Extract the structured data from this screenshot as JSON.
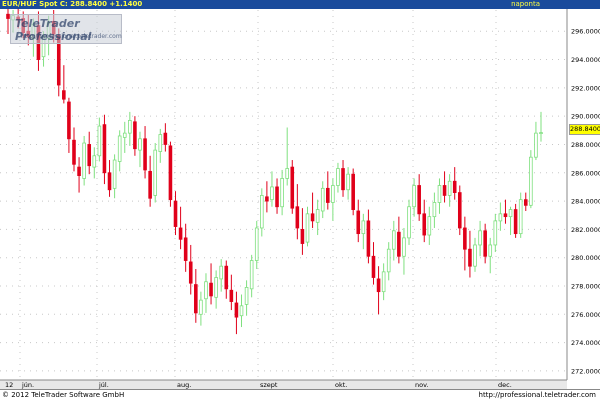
{
  "header": {
    "symbol_line": "EUR/HUF Spot  C: 288.8400  +1.1400",
    "timeframe": "naponta"
  },
  "logo": {
    "title": "TeleTrader Professional",
    "url": "http://professional.teletrader.com"
  },
  "footer": {
    "copyright": "© 2012 TeleTrader Software GmbH",
    "url": "http://professional.teletrader.com"
  },
  "colors": {
    "up": "#7fe07f",
    "down": "#e0001a",
    "grid": "#c8c8c8",
    "axis_bg": "#ffffff",
    "header_bg": "#1a4b9c",
    "last_tag": "#ffff00"
  },
  "chart_data": {
    "type": "candlestick",
    "title": "EUR/HUF Spot",
    "last_close": "288.8400",
    "change": "+1.1400",
    "y_ticks": [
      "296.0000",
      "294.0000",
      "292.0000",
      "290.0000",
      "288.0000",
      "286.0000",
      "284.0000",
      "282.0000",
      "280.0000",
      "278.0000",
      "276.0000",
      "274.0000",
      "272.0000"
    ],
    "ylim": [
      271.5,
      297.5
    ],
    "x_month_labels": [
      "12",
      "jún.",
      "júl.",
      "aug.",
      "szept",
      "okt.",
      "nov.",
      "dec."
    ],
    "grid": true,
    "series": [
      {
        "o": 297.2,
        "h": 297.6,
        "l": 295.8,
        "c": 296.9
      },
      {
        "o": 296.8,
        "h": 297.5,
        "l": 295.9,
        "c": 297.1
      },
      {
        "o": 297.0,
        "h": 297.6,
        "l": 296.2,
        "c": 296.8
      },
      {
        "o": 296.9,
        "h": 297.4,
        "l": 295.5,
        "c": 295.9
      },
      {
        "o": 296.0,
        "h": 297.2,
        "l": 295.0,
        "c": 295.6
      },
      {
        "o": 295.5,
        "h": 296.9,
        "l": 294.2,
        "c": 296.5
      },
      {
        "o": 296.4,
        "h": 297.4,
        "l": 293.2,
        "c": 294.0
      },
      {
        "o": 294.2,
        "h": 296.0,
        "l": 293.5,
        "c": 295.6
      },
      {
        "o": 295.5,
        "h": 297.1,
        "l": 294.3,
        "c": 296.6
      },
      {
        "o": 296.7,
        "h": 297.5,
        "l": 295.2,
        "c": 295.8
      },
      {
        "o": 295.7,
        "h": 296.2,
        "l": 291.4,
        "c": 292.2
      },
      {
        "o": 291.8,
        "h": 293.6,
        "l": 290.9,
        "c": 291.2
      },
      {
        "o": 291.0,
        "h": 291.3,
        "l": 287.4,
        "c": 288.4
      },
      {
        "o": 288.3,
        "h": 289.2,
        "l": 286.1,
        "c": 286.6
      },
      {
        "o": 286.4,
        "h": 287.1,
        "l": 284.6,
        "c": 285.8
      },
      {
        "o": 285.6,
        "h": 288.6,
        "l": 285.1,
        "c": 288.1
      },
      {
        "o": 288.0,
        "h": 288.9,
        "l": 285.9,
        "c": 286.5
      },
      {
        "o": 286.4,
        "h": 287.8,
        "l": 285.6,
        "c": 287.2
      },
      {
        "o": 287.2,
        "h": 289.9,
        "l": 286.8,
        "c": 289.3
      },
      {
        "o": 289.4,
        "h": 290.1,
        "l": 285.2,
        "c": 286.0
      },
      {
        "o": 286.0,
        "h": 286.9,
        "l": 284.3,
        "c": 284.8
      },
      {
        "o": 284.9,
        "h": 287.3,
        "l": 284.2,
        "c": 286.9
      },
      {
        "o": 286.8,
        "h": 289.0,
        "l": 286.1,
        "c": 288.6
      },
      {
        "o": 288.5,
        "h": 289.6,
        "l": 287.4,
        "c": 288.8
      },
      {
        "o": 288.8,
        "h": 290.3,
        "l": 287.9,
        "c": 289.7
      },
      {
        "o": 289.6,
        "h": 290.0,
        "l": 287.2,
        "c": 287.7
      },
      {
        "o": 287.6,
        "h": 288.9,
        "l": 286.4,
        "c": 288.4
      },
      {
        "o": 288.4,
        "h": 289.3,
        "l": 285.6,
        "c": 286.2
      },
      {
        "o": 286.1,
        "h": 287.2,
        "l": 283.6,
        "c": 284.2
      },
      {
        "o": 284.4,
        "h": 288.1,
        "l": 283.9,
        "c": 287.6
      },
      {
        "o": 287.5,
        "h": 289.1,
        "l": 286.7,
        "c": 288.7
      },
      {
        "o": 288.8,
        "h": 289.5,
        "l": 287.5,
        "c": 288.0
      },
      {
        "o": 287.9,
        "h": 288.2,
        "l": 283.6,
        "c": 284.1
      },
      {
        "o": 284.0,
        "h": 284.7,
        "l": 281.6,
        "c": 282.2
      },
      {
        "o": 282.1,
        "h": 283.6,
        "l": 280.6,
        "c": 281.3
      },
      {
        "o": 281.4,
        "h": 282.4,
        "l": 279.0,
        "c": 279.8
      },
      {
        "o": 279.7,
        "h": 280.9,
        "l": 277.4,
        "c": 278.2
      },
      {
        "o": 278.1,
        "h": 279.2,
        "l": 275.4,
        "c": 276.1
      },
      {
        "o": 276.0,
        "h": 277.6,
        "l": 275.2,
        "c": 277.0
      },
      {
        "o": 277.1,
        "h": 278.9,
        "l": 276.1,
        "c": 278.3
      },
      {
        "o": 278.2,
        "h": 279.6,
        "l": 276.7,
        "c": 277.3
      },
      {
        "o": 277.2,
        "h": 279.1,
        "l": 276.4,
        "c": 278.6
      },
      {
        "o": 278.5,
        "h": 279.9,
        "l": 277.6,
        "c": 279.4
      },
      {
        "o": 279.4,
        "h": 279.8,
        "l": 277.1,
        "c": 277.8
      },
      {
        "o": 277.7,
        "h": 278.8,
        "l": 276.3,
        "c": 276.9
      },
      {
        "o": 276.8,
        "h": 277.6,
        "l": 274.6,
        "c": 275.8
      },
      {
        "o": 275.9,
        "h": 277.4,
        "l": 275.1,
        "c": 276.6
      },
      {
        "o": 276.7,
        "h": 278.4,
        "l": 275.9,
        "c": 277.9
      },
      {
        "o": 277.8,
        "h": 280.2,
        "l": 277.2,
        "c": 279.8
      },
      {
        "o": 279.8,
        "h": 282.6,
        "l": 279.2,
        "c": 282.1
      },
      {
        "o": 282.1,
        "h": 284.9,
        "l": 281.5,
        "c": 284.4
      },
      {
        "o": 284.3,
        "h": 285.4,
        "l": 283.2,
        "c": 284.0
      },
      {
        "o": 284.1,
        "h": 286.1,
        "l": 283.6,
        "c": 285.0
      },
      {
        "o": 285.0,
        "h": 285.6,
        "l": 283.1,
        "c": 283.6
      },
      {
        "o": 283.6,
        "h": 286.2,
        "l": 283.0,
        "c": 285.6
      },
      {
        "o": 285.6,
        "h": 289.2,
        "l": 285.1,
        "c": 286.3
      },
      {
        "o": 286.4,
        "h": 286.9,
        "l": 283.1,
        "c": 283.5
      },
      {
        "o": 283.6,
        "h": 285.2,
        "l": 281.3,
        "c": 282.1
      },
      {
        "o": 282.0,
        "h": 283.5,
        "l": 280.2,
        "c": 281.0
      },
      {
        "o": 281.1,
        "h": 283.6,
        "l": 280.8,
        "c": 283.1
      },
      {
        "o": 283.1,
        "h": 284.6,
        "l": 282.1,
        "c": 282.6
      },
      {
        "o": 282.5,
        "h": 284.1,
        "l": 281.6,
        "c": 283.4
      },
      {
        "o": 283.3,
        "h": 285.4,
        "l": 282.8,
        "c": 284.9
      },
      {
        "o": 284.9,
        "h": 286.1,
        "l": 283.4,
        "c": 283.9
      },
      {
        "o": 283.9,
        "h": 285.6,
        "l": 282.6,
        "c": 285.1
      },
      {
        "o": 285.1,
        "h": 286.7,
        "l": 284.6,
        "c": 286.3
      },
      {
        "o": 286.3,
        "h": 286.9,
        "l": 284.3,
        "c": 284.8
      },
      {
        "o": 284.8,
        "h": 286.4,
        "l": 284.1,
        "c": 285.9
      },
      {
        "o": 285.9,
        "h": 286.3,
        "l": 283.0,
        "c": 283.4
      },
      {
        "o": 283.3,
        "h": 284.1,
        "l": 281.1,
        "c": 281.7
      },
      {
        "o": 281.7,
        "h": 283.1,
        "l": 280.6,
        "c": 282.6
      },
      {
        "o": 282.6,
        "h": 283.4,
        "l": 279.6,
        "c": 280.1
      },
      {
        "o": 280.1,
        "h": 281.1,
        "l": 278.1,
        "c": 278.6
      },
      {
        "o": 278.5,
        "h": 279.4,
        "l": 276.0,
        "c": 277.6
      },
      {
        "o": 277.6,
        "h": 279.6,
        "l": 277.0,
        "c": 279.0
      },
      {
        "o": 279.0,
        "h": 281.1,
        "l": 278.4,
        "c": 280.6
      },
      {
        "o": 280.6,
        "h": 282.6,
        "l": 279.8,
        "c": 281.9
      },
      {
        "o": 281.8,
        "h": 282.9,
        "l": 279.6,
        "c": 280.1
      },
      {
        "o": 280.1,
        "h": 282.1,
        "l": 278.8,
        "c": 281.4
      },
      {
        "o": 281.4,
        "h": 284.1,
        "l": 280.9,
        "c": 283.6
      },
      {
        "o": 283.6,
        "h": 285.6,
        "l": 282.9,
        "c": 285.1
      },
      {
        "o": 285.1,
        "h": 285.9,
        "l": 282.6,
        "c": 283.1
      },
      {
        "o": 283.1,
        "h": 284.1,
        "l": 281.1,
        "c": 281.6
      },
      {
        "o": 281.6,
        "h": 283.6,
        "l": 280.9,
        "c": 282.9
      },
      {
        "o": 282.9,
        "h": 284.6,
        "l": 282.1,
        "c": 283.9
      },
      {
        "o": 283.9,
        "h": 285.6,
        "l": 283.1,
        "c": 285.1
      },
      {
        "o": 285.1,
        "h": 286.1,
        "l": 283.9,
        "c": 284.4
      },
      {
        "o": 284.4,
        "h": 285.9,
        "l": 283.6,
        "c": 285.4
      },
      {
        "o": 285.4,
        "h": 286.4,
        "l": 284.1,
        "c": 284.6
      },
      {
        "o": 284.6,
        "h": 285.1,
        "l": 281.6,
        "c": 282.1
      },
      {
        "o": 282.1,
        "h": 282.9,
        "l": 279.1,
        "c": 280.6
      },
      {
        "o": 280.6,
        "h": 281.9,
        "l": 278.6,
        "c": 279.4
      },
      {
        "o": 279.4,
        "h": 281.4,
        "l": 279.0,
        "c": 280.9
      },
      {
        "o": 280.9,
        "h": 282.6,
        "l": 280.1,
        "c": 281.9
      },
      {
        "o": 281.9,
        "h": 282.4,
        "l": 279.6,
        "c": 280.1
      },
      {
        "o": 280.1,
        "h": 281.4,
        "l": 278.9,
        "c": 280.9
      },
      {
        "o": 280.9,
        "h": 283.1,
        "l": 280.4,
        "c": 282.6
      },
      {
        "o": 282.6,
        "h": 283.9,
        "l": 281.9,
        "c": 283.1
      },
      {
        "o": 283.1,
        "h": 284.1,
        "l": 282.4,
        "c": 282.9
      },
      {
        "o": 282.9,
        "h": 283.6,
        "l": 281.6,
        "c": 283.4
      },
      {
        "o": 283.4,
        "h": 283.8,
        "l": 281.4,
        "c": 281.7
      },
      {
        "o": 281.7,
        "h": 284.6,
        "l": 281.4,
        "c": 284.1
      },
      {
        "o": 284.1,
        "h": 284.6,
        "l": 283.3,
        "c": 283.7
      },
      {
        "o": 283.7,
        "h": 287.6,
        "l": 283.5,
        "c": 287.1
      },
      {
        "o": 287.1,
        "h": 289.6,
        "l": 286.9,
        "c": 288.8
      },
      {
        "o": 288.8,
        "h": 290.3,
        "l": 288.2,
        "c": 288.84
      }
    ]
  }
}
